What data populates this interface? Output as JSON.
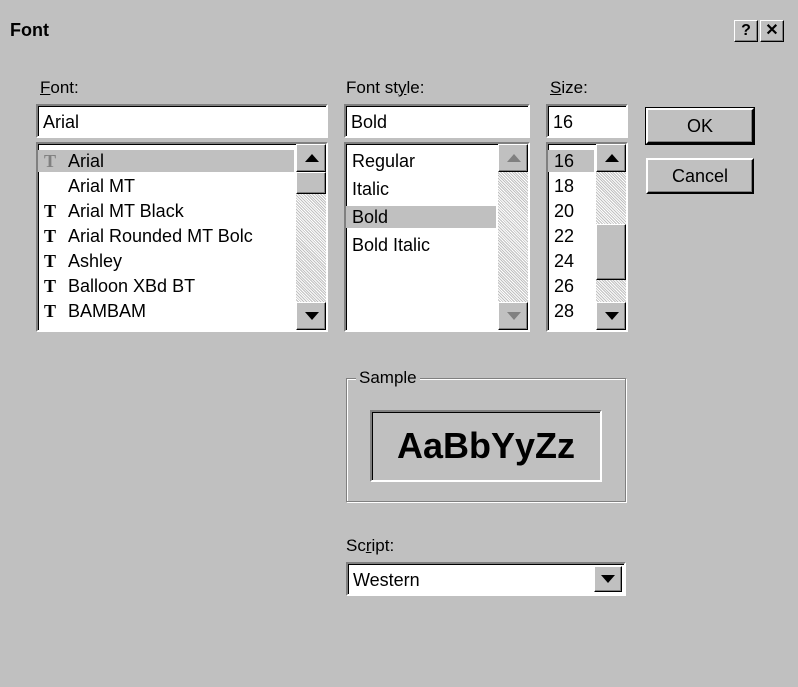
{
  "window": {
    "title": "Font",
    "help_label": "?",
    "close_label": "✕"
  },
  "font": {
    "label_accel": "F",
    "label_rest": "ont:",
    "value": "Arial",
    "items": [
      {
        "label": "Arial",
        "truetype": true,
        "selected": true
      },
      {
        "label": "Arial MT",
        "truetype": false,
        "selected": false
      },
      {
        "label": "Arial MT Black",
        "truetype": true,
        "selected": false
      },
      {
        "label": "Arial Rounded MT Bolc",
        "truetype": true,
        "selected": false
      },
      {
        "label": "Ashley",
        "truetype": true,
        "selected": false
      },
      {
        "label": "Balloon XBd BT",
        "truetype": true,
        "selected": false
      },
      {
        "label": "BAMBAM",
        "truetype": true,
        "selected": false
      }
    ]
  },
  "style": {
    "label_pre": "Font st",
    "label_accel": "y",
    "label_rest": "le:",
    "value": "Bold",
    "items": [
      "Regular",
      "Italic",
      "Bold",
      "Bold Italic"
    ],
    "selected": "Bold"
  },
  "size": {
    "label_accel": "S",
    "label_rest": "ize:",
    "value": "16",
    "items": [
      "16",
      "18",
      "20",
      "22",
      "24",
      "26",
      "28"
    ],
    "selected": "16"
  },
  "buttons": {
    "ok": "OK",
    "cancel": "Cancel"
  },
  "sample": {
    "label": "Sample",
    "text": "AaBbYyZz"
  },
  "script": {
    "label_pre": "Sc",
    "label_accel": "r",
    "label_rest": "ipt:",
    "value": "Western"
  },
  "colors": {
    "face": "#c0c0c0",
    "selection": "#c0c0c0",
    "field": "#ffffff"
  },
  "icons": {
    "truetype": "truetype-font-icon",
    "scroll_up": "arrow-up-icon",
    "scroll_down": "arrow-down-icon"
  }
}
